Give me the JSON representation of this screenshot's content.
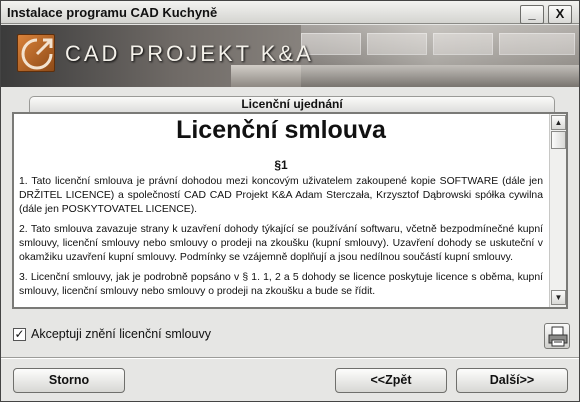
{
  "window": {
    "title": "Instalace programu CAD Kuchyně",
    "minimize_label": "_",
    "close_label": "X"
  },
  "banner": {
    "logo_icon": "cad-logo-icon",
    "brand_text": "CAD PROJEKT K&A"
  },
  "tab": {
    "label": "Licenční ujednání"
  },
  "license": {
    "heading": "Licenční smlouva",
    "section": "§1",
    "paragraphs": [
      "1. Tato licenční smlouva je právní dohodou mezi koncovým uživatelem zakoupené kopie SOFTWARE (dále jen DRŽITEL LICENCE) a společností CAD CAD Projekt K&A Adam Sterczała, Krzysztof Dąbrowski spółka cywilna (dále jen POSKYTOVATEL LICENCE).",
      "2. Tato smlouva zavazuje strany k uzavření dohody týkající se používání softwaru, včetně bezpodmínečné kupní smlouvy, licenční smlouvy nebo smlouvy o prodeji na zkoušku (kupní smlouvy). Uzavření dohody se uskuteční v okamžiku uzavření kupní smlouvy. Podmínky se vzájemně doplňují a jsou nedílnou součástí kupní smlouvy.",
      "3. Licenční smlouvy, jak je podrobně popsáno v § 1. 1, 2 a 5 dohody se licence poskytuje licence s oběma, kupní smlouvy, licenční smlouvy nebo smlouvy o prodeji na zkoušku a bude se řídit."
    ]
  },
  "scrollbar": {
    "up_icon": "▲",
    "down_icon": "▼"
  },
  "accept": {
    "checked_mark": "✓",
    "label": "Akceptuji znění licenční smlouvy",
    "checked": true
  },
  "print": {
    "icon": "printer-icon"
  },
  "buttons": {
    "cancel": "Storno",
    "back": "<<Zpět",
    "next": "Další>>"
  }
}
